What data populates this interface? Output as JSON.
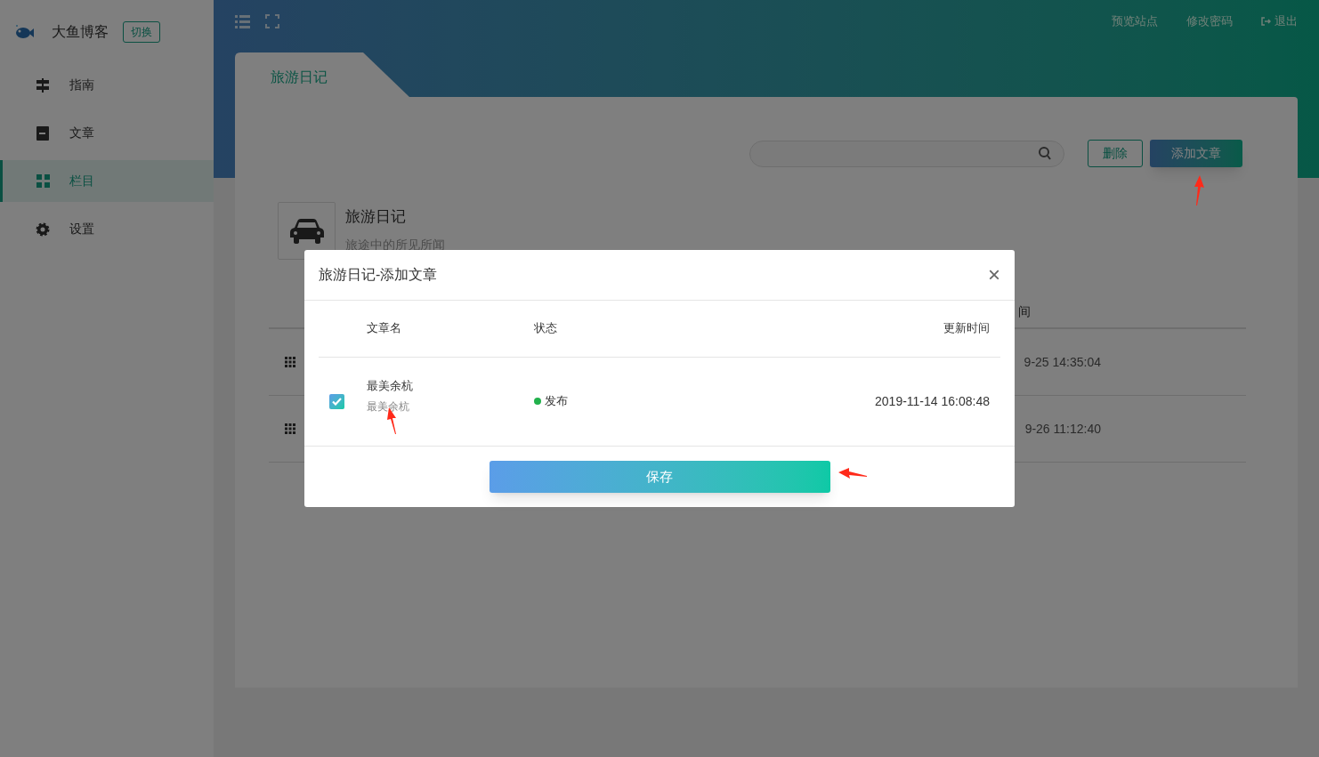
{
  "brand": {
    "name": "大鱼博客",
    "switch_label": "切换"
  },
  "sidebar": {
    "items": [
      {
        "label": "指南",
        "selected": false
      },
      {
        "label": "文章",
        "selected": false
      },
      {
        "label": "栏目",
        "selected": true
      },
      {
        "label": "设置",
        "selected": false
      }
    ]
  },
  "top_links": [
    {
      "label": "预览站点",
      "kind": "link"
    },
    {
      "label": "修改密码",
      "kind": "link"
    },
    {
      "label": "退出",
      "kind": "exit"
    }
  ],
  "tab": {
    "label": "旅游日记"
  },
  "toolbar": {
    "delete_label": "删除",
    "add_label": "添加文章"
  },
  "column_info": {
    "title": "旅游日记",
    "subtitle": "旅途中的所见所闻"
  },
  "background_table": {
    "column_last": "间",
    "rows": [
      {
        "time": "9-25 14:35:04"
      },
      {
        "time": "9-26 11:12:40"
      }
    ]
  },
  "dialog": {
    "title": "旅游日记-添加文章",
    "close": "×",
    "columns": [
      "文章名",
      "状态",
      "更新时间"
    ],
    "rows": [
      {
        "checked": true,
        "name": "最美余杭",
        "subtitle": "最美余杭",
        "status": "发布",
        "color": "#22b14c",
        "updated": "2019-11-14 16:08:48"
      }
    ],
    "save_label": "保存"
  }
}
